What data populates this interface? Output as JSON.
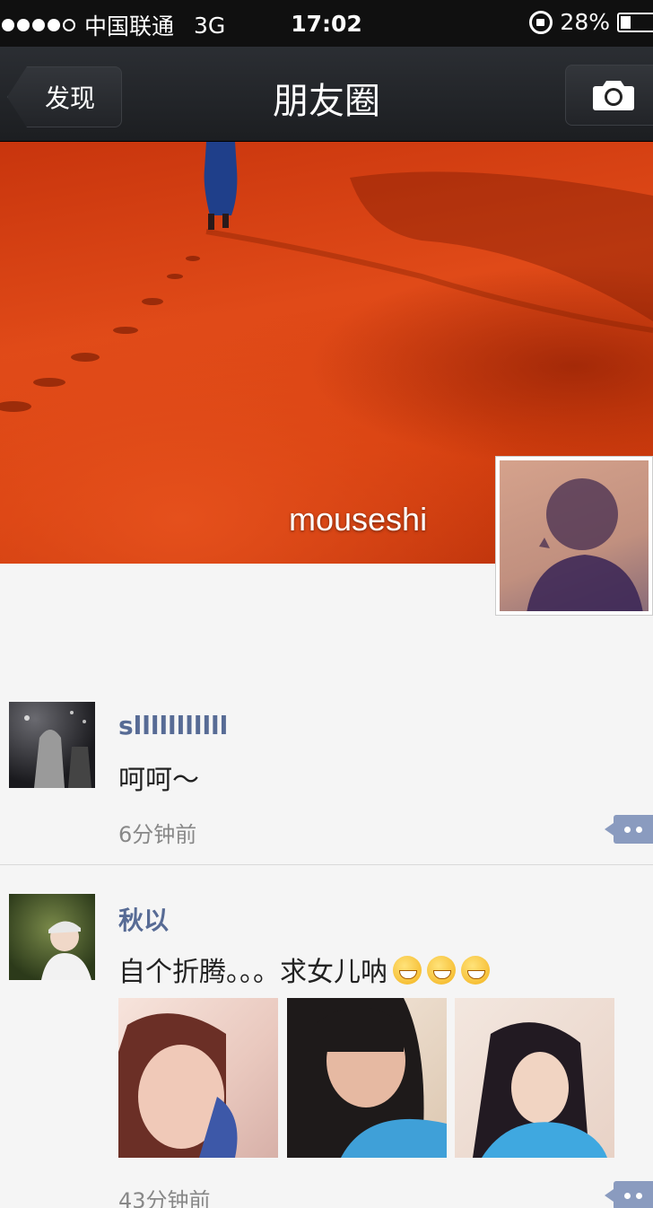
{
  "status_bar": {
    "carrier": "中国联通",
    "network": "3G",
    "time": "17:02",
    "battery": "28%",
    "battery_level": 0.28
  },
  "nav": {
    "back_label": "发现",
    "title": "朋友圈"
  },
  "cover": {
    "username": "mouseshi"
  },
  "posts": [
    {
      "name": "slllllllllll",
      "text": "呵呵～",
      "time": "6分钟前"
    },
    {
      "name": "秋以",
      "text": "自个折腾。。。求女儿呐",
      "emoji_count": 3,
      "photo_count": 3,
      "time": "43分钟前"
    }
  ],
  "colors": {
    "name_blue": "#576b95",
    "nav_bg": "#1c1e21",
    "cover_red": "#d6400f"
  }
}
